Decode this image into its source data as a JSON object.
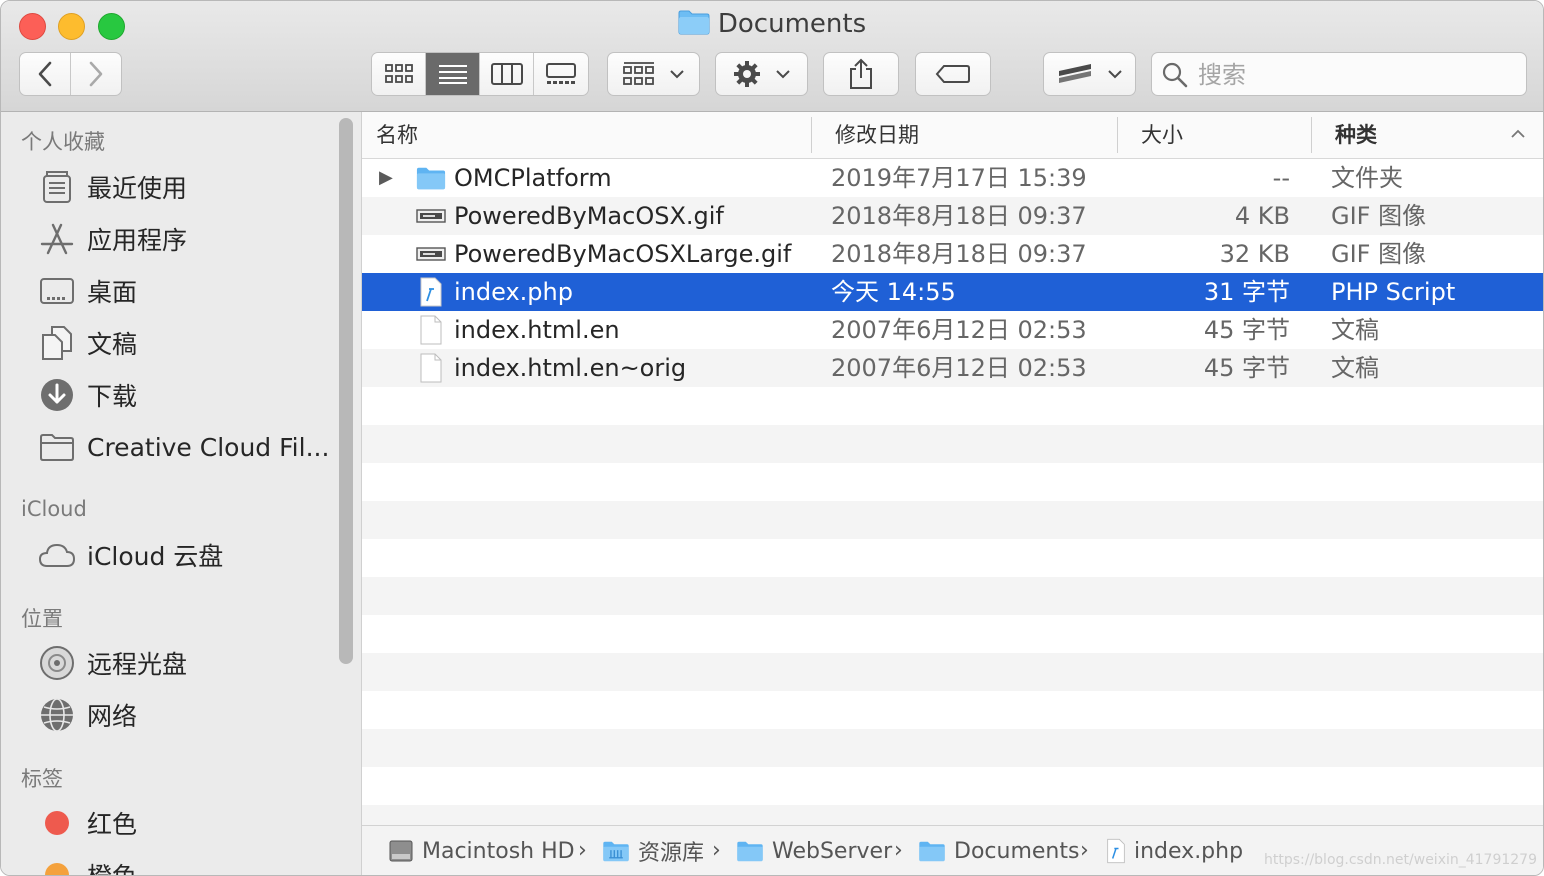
{
  "window": {
    "title": "Documents"
  },
  "search": {
    "placeholder": "搜索"
  },
  "sidebar": {
    "favorites_label": "个人收藏",
    "favorites": [
      {
        "label": "最近使用",
        "icon": "recents-icon"
      },
      {
        "label": "应用程序",
        "icon": "applications-icon"
      },
      {
        "label": "桌面",
        "icon": "desktop-icon"
      },
      {
        "label": "文稿",
        "icon": "documents-icon"
      },
      {
        "label": "下载",
        "icon": "downloads-icon"
      },
      {
        "label": "Creative Cloud Fil...",
        "icon": "folder-icon"
      }
    ],
    "icloud_label": "iCloud",
    "icloud": [
      {
        "label": "iCloud 云盘",
        "icon": "cloud-icon"
      }
    ],
    "locations_label": "位置",
    "locations": [
      {
        "label": "远程光盘",
        "icon": "disc-icon"
      },
      {
        "label": "网络",
        "icon": "network-icon"
      }
    ],
    "tags_label": "标签",
    "tags": [
      {
        "label": "红色",
        "color": "#ee5a4e"
      },
      {
        "label": "橙色",
        "color": "#f4a13c"
      }
    ]
  },
  "columns": {
    "name": "名称",
    "date": "修改日期",
    "size": "大小",
    "kind": "种类"
  },
  "files": [
    {
      "name": "OMCPlatform",
      "date": "2019年7月17日 15:39",
      "size": "--",
      "kind": "文件夹",
      "icon": "folder-icon",
      "disclosure": "▶"
    },
    {
      "name": "PoweredByMacOSX.gif",
      "date": "2018年8月18日 09:37",
      "size": "4 KB",
      "kind": "GIF 图像",
      "icon": "gif-icon"
    },
    {
      "name": "PoweredByMacOSXLarge.gif",
      "date": "2018年8月18日 09:37",
      "size": "32 KB",
      "kind": "GIF 图像",
      "icon": "gif-icon"
    },
    {
      "name": "index.php",
      "date": "今天 14:55",
      "size": "31 字节",
      "kind": "PHP Script",
      "icon": "php-file-icon",
      "selected": true
    },
    {
      "name": "index.html.en",
      "date": "2007年6月12日 02:53",
      "size": "45 字节",
      "kind": "文稿",
      "icon": "document-icon"
    },
    {
      "name": "index.html.en~orig",
      "date": "2007年6月12日 02:53",
      "size": "45 字节",
      "kind": "文稿",
      "icon": "document-icon"
    }
  ],
  "pathbar": [
    {
      "label": "Macintosh HD",
      "icon": "hard-drive-icon"
    },
    {
      "label": "资源库",
      "icon": "library-folder-icon"
    },
    {
      "label": "WebServer",
      "icon": "folder-icon"
    },
    {
      "label": "Documents",
      "icon": "folder-icon"
    },
    {
      "label": "index.php",
      "icon": "php-file-icon"
    }
  ],
  "pathbar_separator": "›",
  "watermark": "https://blog.csdn.net/weixin_41791279",
  "colors": {
    "selection": "#1f60d6",
    "folder": "#5fb4f2"
  }
}
